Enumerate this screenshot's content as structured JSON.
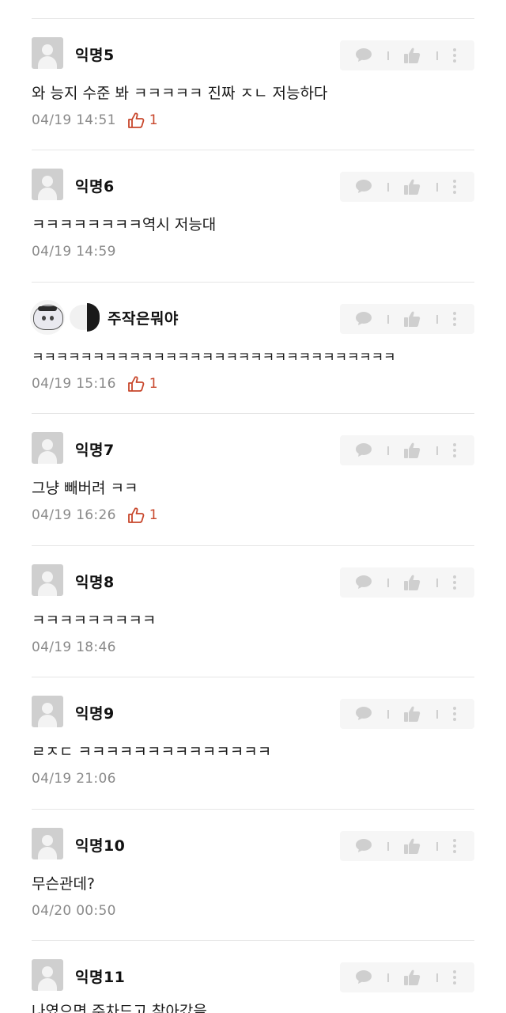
{
  "comments": [
    {
      "name": "익명5",
      "text": "와 능지 수준 봐 ㅋㅋㅋㅋㅋ 진짜 ㅈㄴ 저능하다",
      "time": "04/19 14:51",
      "likes": "1"
    },
    {
      "name": "익명6",
      "text": "ㅋㅋㅋㅋㅋㅋㅋㅋ역시 저능대",
      "time": "04/19 14:59",
      "likes": ""
    },
    {
      "name": "주작은뭐야",
      "text": "ㅋㅋㅋㅋㅋㅋㅋㅋㅋㅋㅋㅋㅋㅋㅋㅋㅋㅋㅋㅋㅋㅋㅋㅋㅋㅋㅋㅋㅋㅋ",
      "time": "04/19 15:16",
      "likes": "1"
    },
    {
      "name": "익명7",
      "text": "그냥 빼버려 ㅋㅋ",
      "time": "04/19 16:26",
      "likes": "1"
    },
    {
      "name": "익명8",
      "text": "ㅋㅋㅋㅋㅋㅋㅋㅋㅋ",
      "time": "04/19 18:46",
      "likes": ""
    },
    {
      "name": "익명9",
      "text": "ㄹㅈㄷ ㅋㅋㅋㅋㅋㅋㅋㅋㅋㅋㅋㅋㅋㅋ",
      "time": "04/19 21:06",
      "likes": ""
    },
    {
      "name": "익명10",
      "text": "무슨관데?",
      "time": "04/20 00:50",
      "likes": ""
    },
    {
      "name": "익명11",
      "text": "나였으면 주차드고 찾아갔을",
      "time": "",
      "likes": ""
    }
  ],
  "icons": {
    "comment": "speech-bubble-icon",
    "like": "thumbs-up-icon",
    "more": "vertical-dots-icon",
    "like_outline": "thumbs-up-outline-icon"
  },
  "colors": {
    "like_accent": "#c8472c",
    "timestamp": "#8a8a8a",
    "action_bg": "#f6f6f6",
    "action_icon": "#cfcfcf"
  }
}
